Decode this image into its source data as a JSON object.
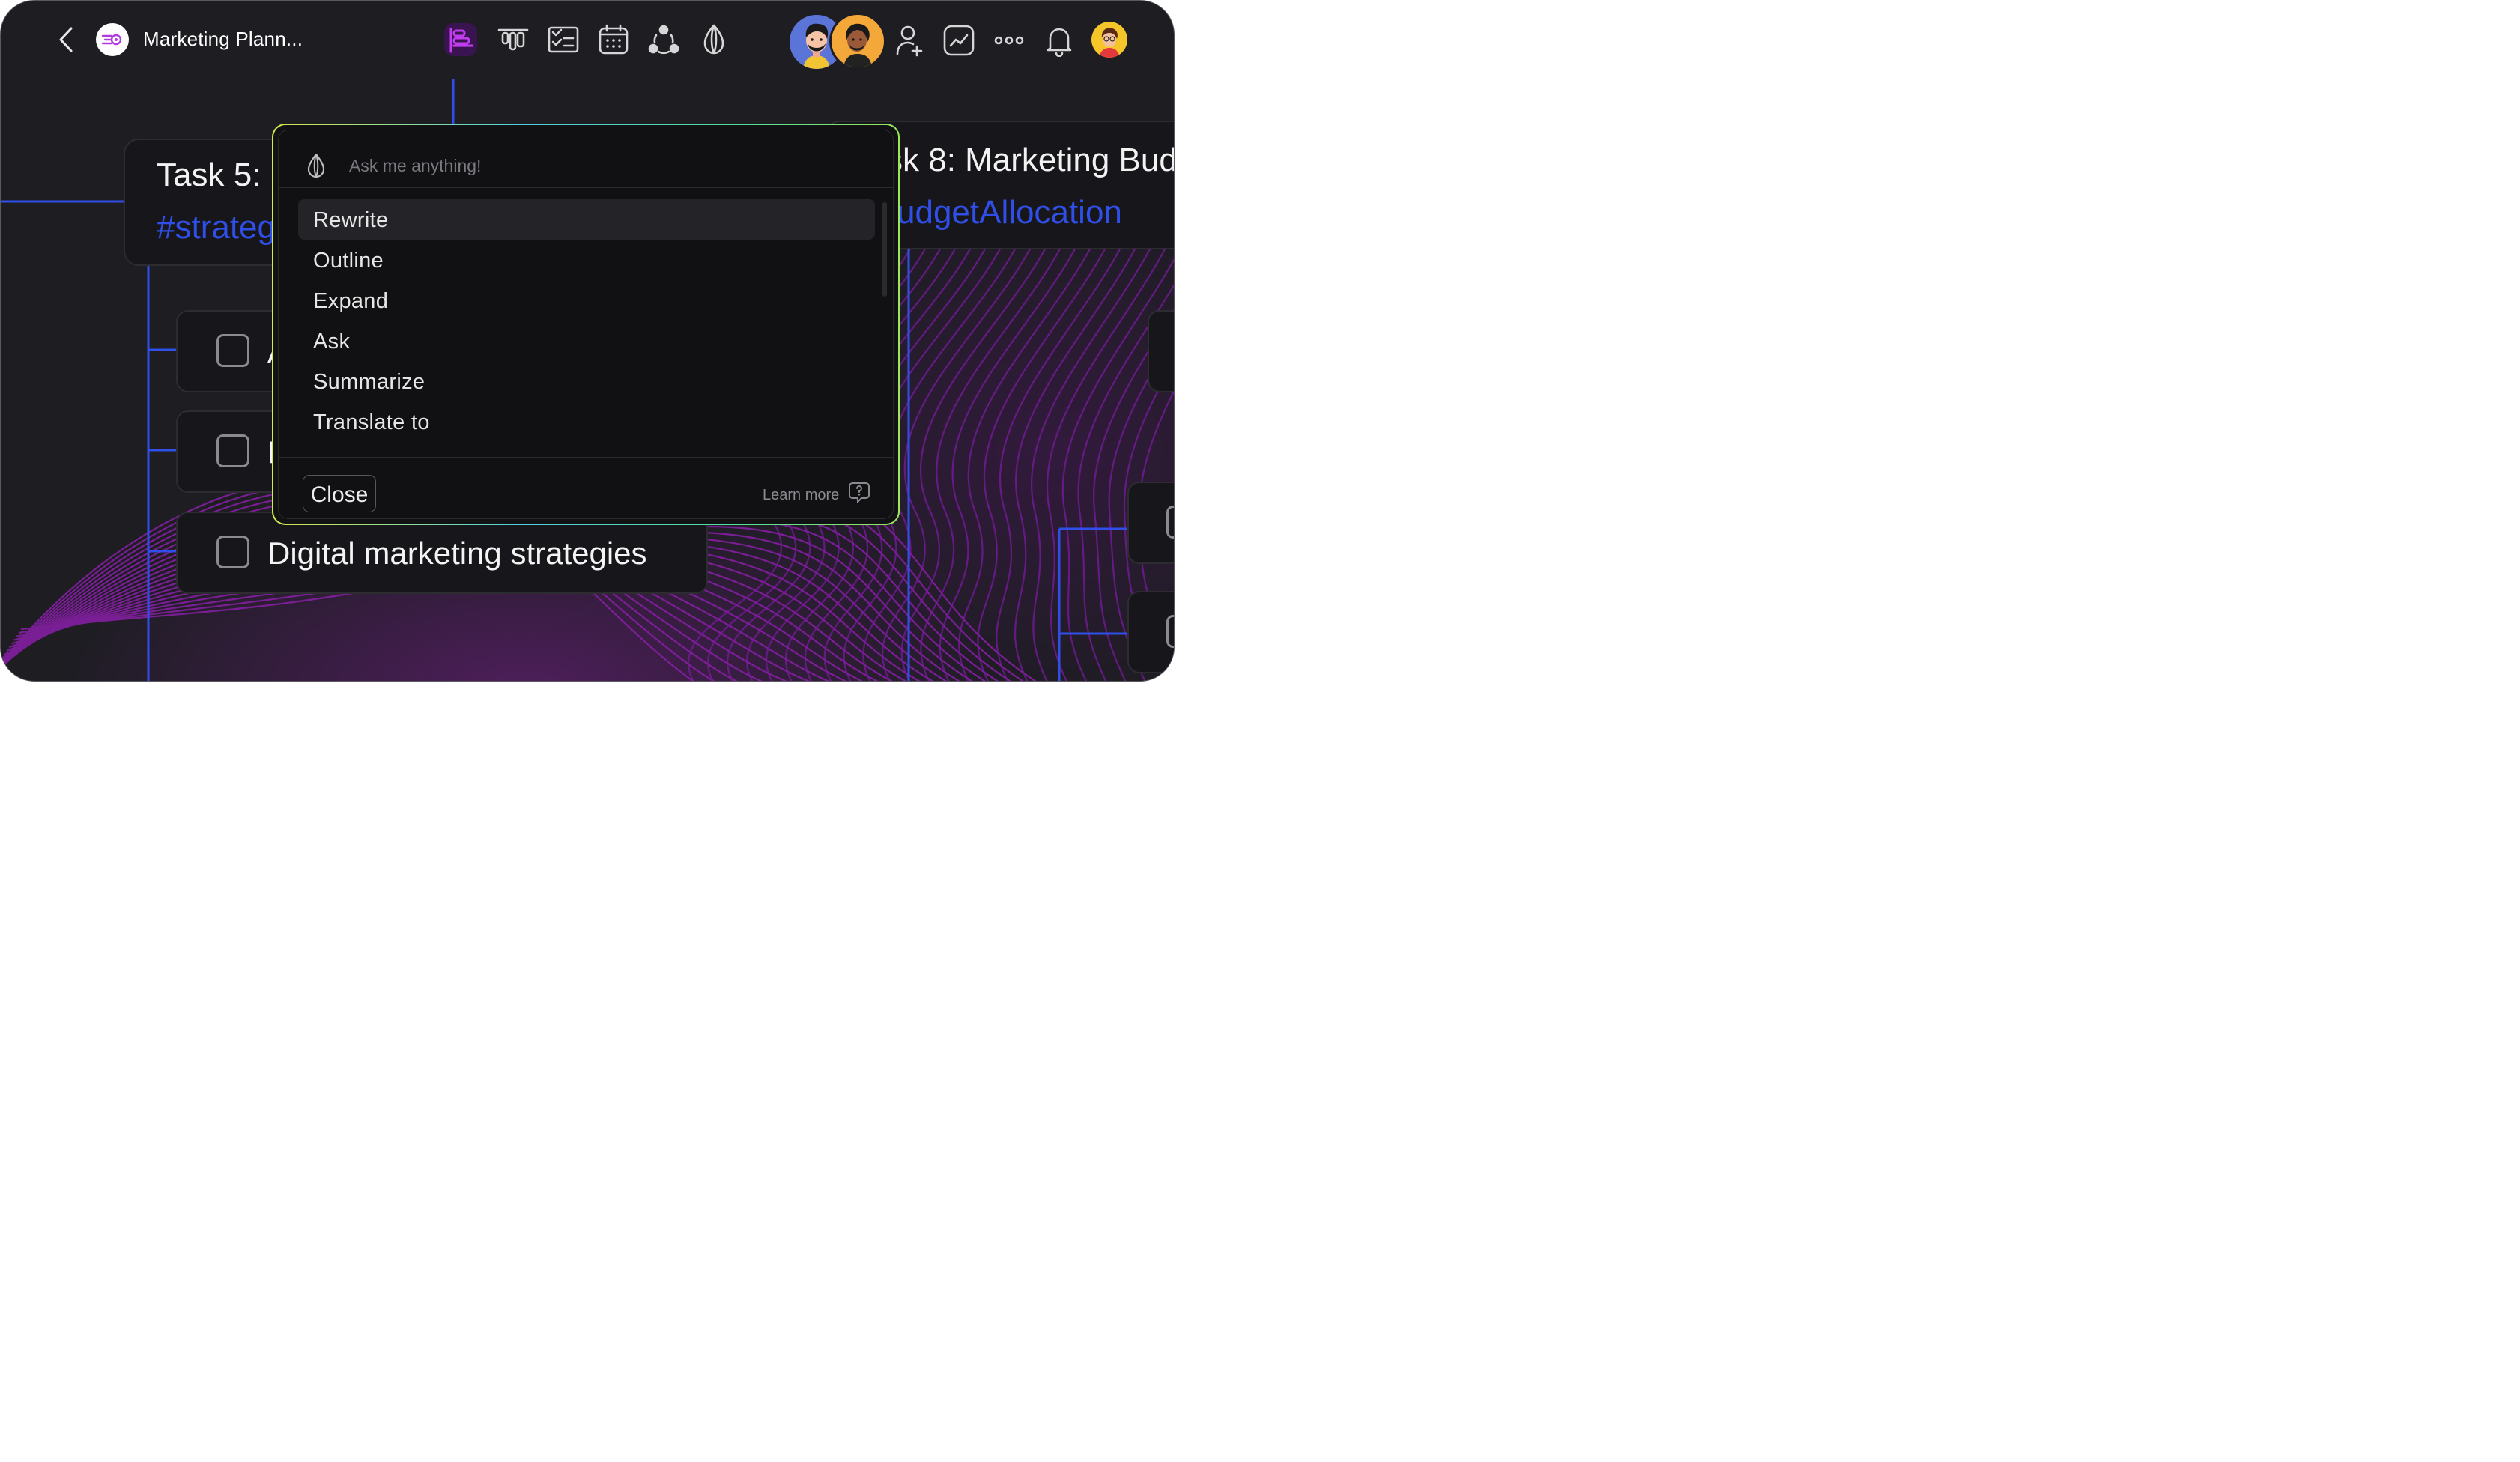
{
  "header": {
    "title": "Marketing Plann...",
    "icons": [
      "back-chevron-icon",
      "app-logo-icon",
      "gantt-view-icon",
      "board-view-icon",
      "checklist-view-icon",
      "calendar-view-icon",
      "mindmap-view-icon",
      "ai-assistant-icon"
    ],
    "right_icons": [
      "add-user-icon",
      "analytics-icon",
      "more-icon",
      "bell-icon"
    ],
    "accent": "#a02bd6"
  },
  "canvas": {
    "task5": {
      "title": "Task 5:",
      "tag": "#strateg"
    },
    "task8": {
      "title": "sk 8: Marketing Bud",
      "tag": "udgetAllocation"
    },
    "items": [
      {
        "text": "A"
      },
      {
        "text": "P"
      },
      {
        "text": "Digital marketing strategies"
      }
    ],
    "line_color": "#2f4fe8",
    "tag_color": "#2f4fe8"
  },
  "ai_popup": {
    "placeholder": "Ask me anything!",
    "menu": [
      "Rewrite",
      "Outline",
      "Expand",
      "Ask",
      "Summarize",
      "Translate to"
    ],
    "active_index": 0,
    "close_label": "Close",
    "learn_more": "Learn more"
  }
}
